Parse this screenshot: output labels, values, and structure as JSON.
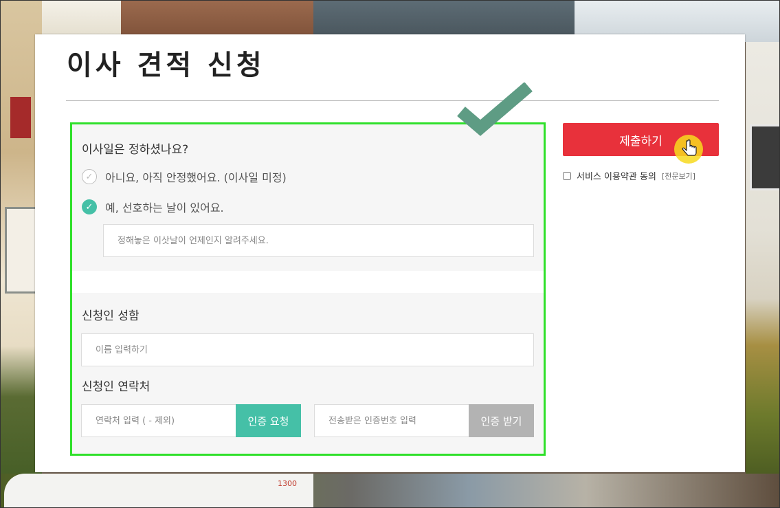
{
  "page": {
    "title": "이사 견적 신청"
  },
  "moving_date": {
    "question": "이사일은 정하셨나요?",
    "options": [
      {
        "label": "아니요, 아직 안정했어요. (이사일 미정)",
        "selected": false
      },
      {
        "label": "예, 선호하는 날이 있어요.",
        "selected": true
      }
    ],
    "date_input": {
      "value": "",
      "placeholder": "정해놓은 이삿날이 언제인지 알려주세요."
    }
  },
  "applicant": {
    "name_label": "신청인 성함",
    "name_input": {
      "value": "",
      "placeholder": "이름 입력하기"
    },
    "contact_label": "신청인 연락처",
    "phone_input": {
      "value": "",
      "placeholder": "연락처 입력 ( - 제외)"
    },
    "request_code_label": "인증 요청",
    "code_input": {
      "value": "",
      "placeholder": "전송받은 인증번호 입력"
    },
    "receive_code_label": "인증 받기"
  },
  "sidebar": {
    "submit_label": "제출하기",
    "agree_label": "서비스 이용약관 동의",
    "terms_link": "[전문보기]",
    "agree_checked": false
  },
  "background": {
    "van_number": "1300"
  },
  "colors": {
    "submit": "#e8313b",
    "teal": "#45c0a7",
    "gray_button": "#b3b3b3",
    "highlight_border": "#2fe02a",
    "check_graphic": "#5e9c84"
  },
  "icons": {
    "unchecked": "circle-check-outline-icon",
    "checked": "circle-check-filled-icon",
    "big_check": "large-checkmark-icon",
    "cursor": "hand-pointer-icon"
  }
}
